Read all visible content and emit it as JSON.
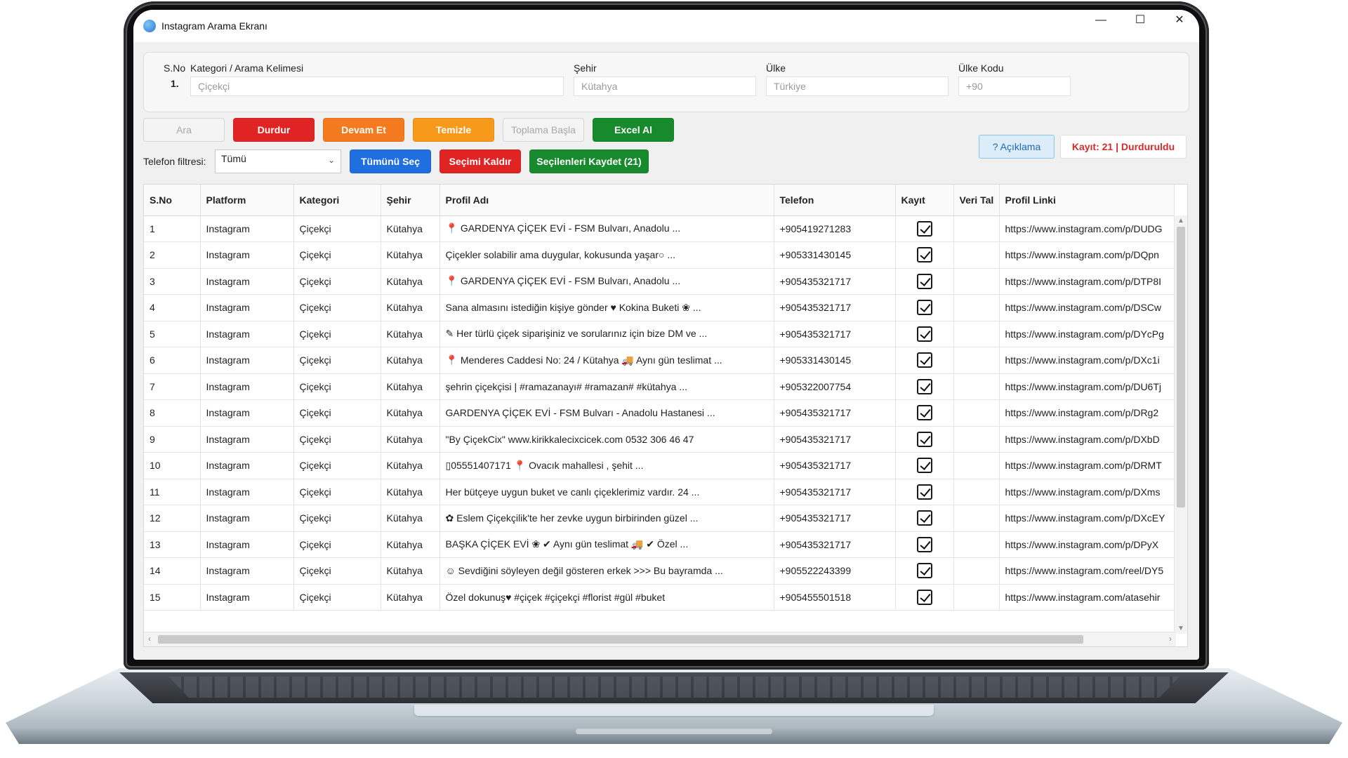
{
  "window": {
    "title": "Instagram Arama Ekranı",
    "minimize_glyph": "—",
    "maximize_glyph": "☐",
    "close_glyph": "✕"
  },
  "search": {
    "sno_label": "S.No",
    "sno_value": "1.",
    "category_label": "Kategori / Arama Kelimesi",
    "category_placeholder": "Çiçekçi",
    "city_label": "Şehir",
    "city_placeholder": "Kütahya",
    "country_label": "Ülke",
    "country_placeholder": "Türkiye",
    "country_code_label": "Ülke Kodu",
    "country_code_placeholder": "+90"
  },
  "toolbar": {
    "search_label": "Ara",
    "stop_label": "Durdur",
    "continue_label": "Devam Et",
    "clear_label": "Temizle",
    "collect_label": "Toplama Başla",
    "excel_label": "Excel Al",
    "phone_filter_label": "Telefon filtresi:",
    "phone_filter_value": "Tümü",
    "select_all_label": "Tümünü Seç",
    "deselect_label": "Seçimi Kaldır",
    "save_selected_label": "Seçilenleri Kaydet (21)",
    "help_label": "? Açıklama",
    "status_label": "Kayıt: 21 | Durduruldu"
  },
  "colors": {
    "stop": "#e02424",
    "continue": "#f47a1f",
    "clear": "#f79a1b",
    "excel": "#178a2d",
    "select_all": "#1f6fe0",
    "deselect": "#e02424",
    "save_selected": "#178a2d",
    "status_text": "#d42b2b"
  },
  "table": {
    "columns": [
      "S.No",
      "Platform",
      "Kategori",
      "Şehir",
      "Profil Adı",
      "Telefon",
      "Kayıt",
      "Veri Tal",
      "Profil Linki"
    ],
    "rows": [
      [
        "1",
        "Instagram",
        "Çiçekçi",
        "Kütahya",
        "📍 GARDENYA ÇİÇEK EVİ - FSM Bulvarı, Anadolu ...",
        "+905419271283",
        "https://www.instagram.com/p/DUDG"
      ],
      [
        "2",
        "Instagram",
        "Çiçekçi",
        "Kütahya",
        "Çiçekler solabilir ama duygular, kokusunda yaşar○ ...",
        "+905331430145",
        "https://www.instagram.com/p/DQpn"
      ],
      [
        "3",
        "Instagram",
        "Çiçekçi",
        "Kütahya",
        "📍 GARDENYA ÇİÇEK EVİ - FSM Bulvarı, Anadolu ...",
        "+905435321717",
        "https://www.instagram.com/p/DTP8I"
      ],
      [
        "4",
        "Instagram",
        "Çiçekçi",
        "Kütahya",
        "Sana almasını istediğin kişiye gönder ♥ Kokina Buketi ❀ ...",
        "+905435321717",
        "https://www.instagram.com/p/DSCw"
      ],
      [
        "5",
        "Instagram",
        "Çiçekçi",
        "Kütahya",
        "✎ Her türlü çiçek siparişiniz ve sorularınız için bize DM ve ...",
        "+905435321717",
        "https://www.instagram.com/p/DYcPg"
      ],
      [
        "6",
        "Instagram",
        "Çiçekçi",
        "Kütahya",
        "📍 Menderes Caddesi No: 24 / Kütahya 🚚 Aynı gün teslimat ...",
        "+905331430145",
        "https://www.instagram.com/p/DXc1i"
      ],
      [
        "7",
        "Instagram",
        "Çiçekçi",
        "Kütahya",
        "şehrin çiçekçisi | #ramazanayı# #ramazan# #kütahya ...",
        "+905322007754",
        "https://www.instagram.com/p/DU6Tj"
      ],
      [
        "8",
        "Instagram",
        "Çiçekçi",
        "Kütahya",
        "GARDENYA ÇİÇEK EVİ - FSM Bulvarı - Anadolu Hastanesi ...",
        "+905435321717",
        "https://www.instagram.com/p/DRg2"
      ],
      [
        "9",
        "Instagram",
        "Çiçekçi",
        "Kütahya",
        "\"By ÇiçekCix\" www.kirikkalecixcicek.com 0532 306 46 47",
        "+905435321717",
        "https://www.instagram.com/p/DXbD"
      ],
      [
        "10",
        "Instagram",
        "Çiçekçi",
        "Kütahya",
        "▯05551407171 📍 Ovacık mahallesi , şehit ...",
        "+905435321717",
        "https://www.instagram.com/p/DRMT"
      ],
      [
        "11",
        "Instagram",
        "Çiçekçi",
        "Kütahya",
        "Her bütçeye uygun buket ve canlı çiçeklerimiz vardır. 24 ...",
        "+905435321717",
        "https://www.instagram.com/p/DXms"
      ],
      [
        "12",
        "Instagram",
        "Çiçekçi",
        "Kütahya",
        "✿ Eslem Çiçekçilik'te her zevke uygun birbirinden güzel ...",
        "+905435321717",
        "https://www.instagram.com/p/DXcEY"
      ],
      [
        "13",
        "Instagram",
        "Çiçekçi",
        "Kütahya",
        "BAŞKA ÇİÇEK EVİ ❀ ✔ Aynı gün teslimat 🚚 ✔ Özel ...",
        "+905435321717",
        "https://www.instagram.com/p/DPyX"
      ],
      [
        "14",
        "Instagram",
        "Çiçekçi",
        "Kütahya",
        "☺ Sevdiğini söyleyen değil gösteren erkek >>> Bu bayramda ...",
        "+905522243399",
        "https://www.instagram.com/reel/DY5"
      ],
      [
        "15",
        "Instagram",
        "Çiçekçi",
        "Kütahya",
        "Özel dokunuş♥ #çiçek #çiçekçi #florist #gül #buket",
        "+905455501518",
        "https://www.instagram.com/atasehir"
      ]
    ]
  }
}
